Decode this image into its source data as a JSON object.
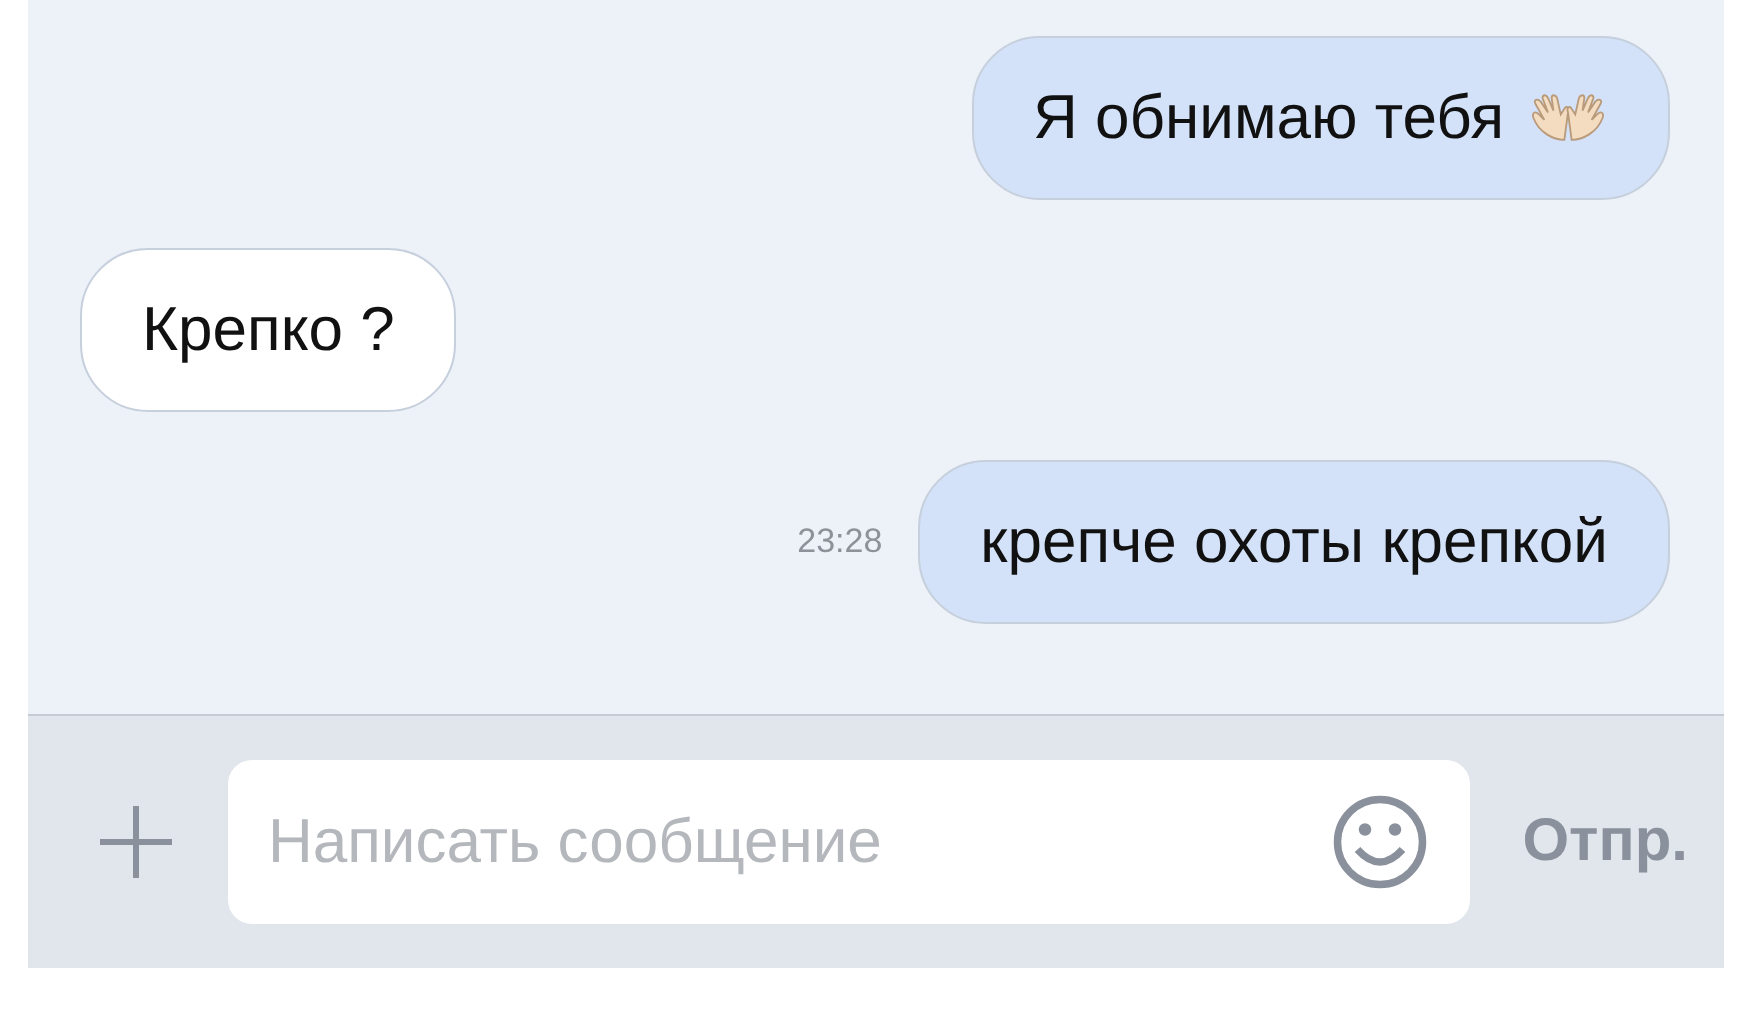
{
  "messages": [
    {
      "outgoing": true,
      "text": "Я обнимаю тебя",
      "emoji": true
    },
    {
      "outgoing": false,
      "text": "Крепко ?"
    },
    {
      "outgoing": true,
      "text": "крепче охоты крепкой",
      "time": "23:28"
    }
  ],
  "composer": {
    "placeholder": "Написать сообщение",
    "send": "Отпр."
  }
}
